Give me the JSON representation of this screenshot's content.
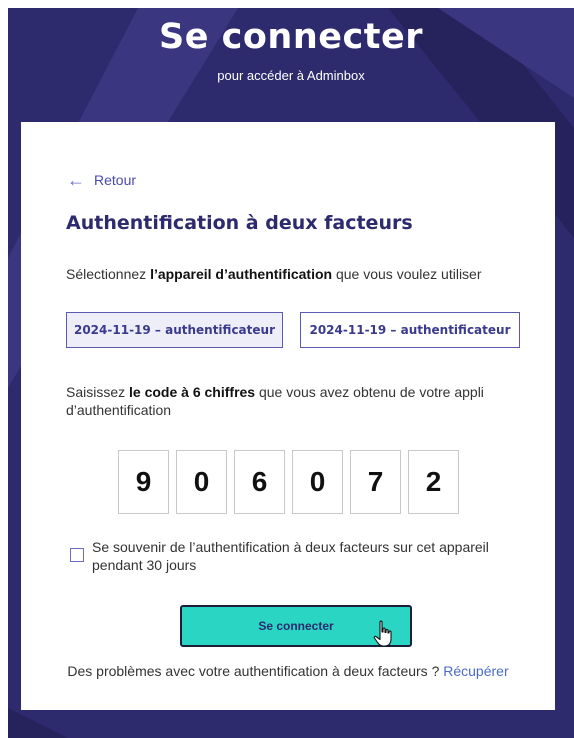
{
  "header": {
    "title": "Se connecter",
    "subtitle": "pour accéder à Adminbox"
  },
  "card": {
    "back_label": "Retour",
    "title": "Authentification à deux facteurs",
    "device_prompt": {
      "before": "Sélectionnez ",
      "bold": "l’appareil d’authentification",
      "after": " que vous voulez utiliser"
    },
    "devices": [
      {
        "label": "2024-11-19 – authentificateur",
        "selected": true
      },
      {
        "label": "2024-11-19 – authentificateur",
        "selected": false
      }
    ],
    "code_prompt": {
      "before": "Saisissez ",
      "bold": "le code à 6 chiffres",
      "after": " que vous avez obtenu de votre appli d’authentification"
    },
    "code_digits": [
      "9",
      "0",
      "6",
      "0",
      "7",
      "2"
    ],
    "remember_label": "Se souvenir de l’authentification à deux facteurs sur cet appareil pendant 30 jours",
    "remember_checked": false,
    "submit_label": "Se connecter",
    "recover_text": "Des problèmes avec votre authentification à deux facteurs ? ",
    "recover_link": "Récupérer"
  },
  "colors": {
    "brand_dark": "#2e2a6e",
    "accent_teal": "#2bd5c4",
    "link_blue": "#4a6cc7"
  },
  "icons": {
    "back": "arrow-left-icon",
    "cursor": "hand-pointer-icon"
  }
}
